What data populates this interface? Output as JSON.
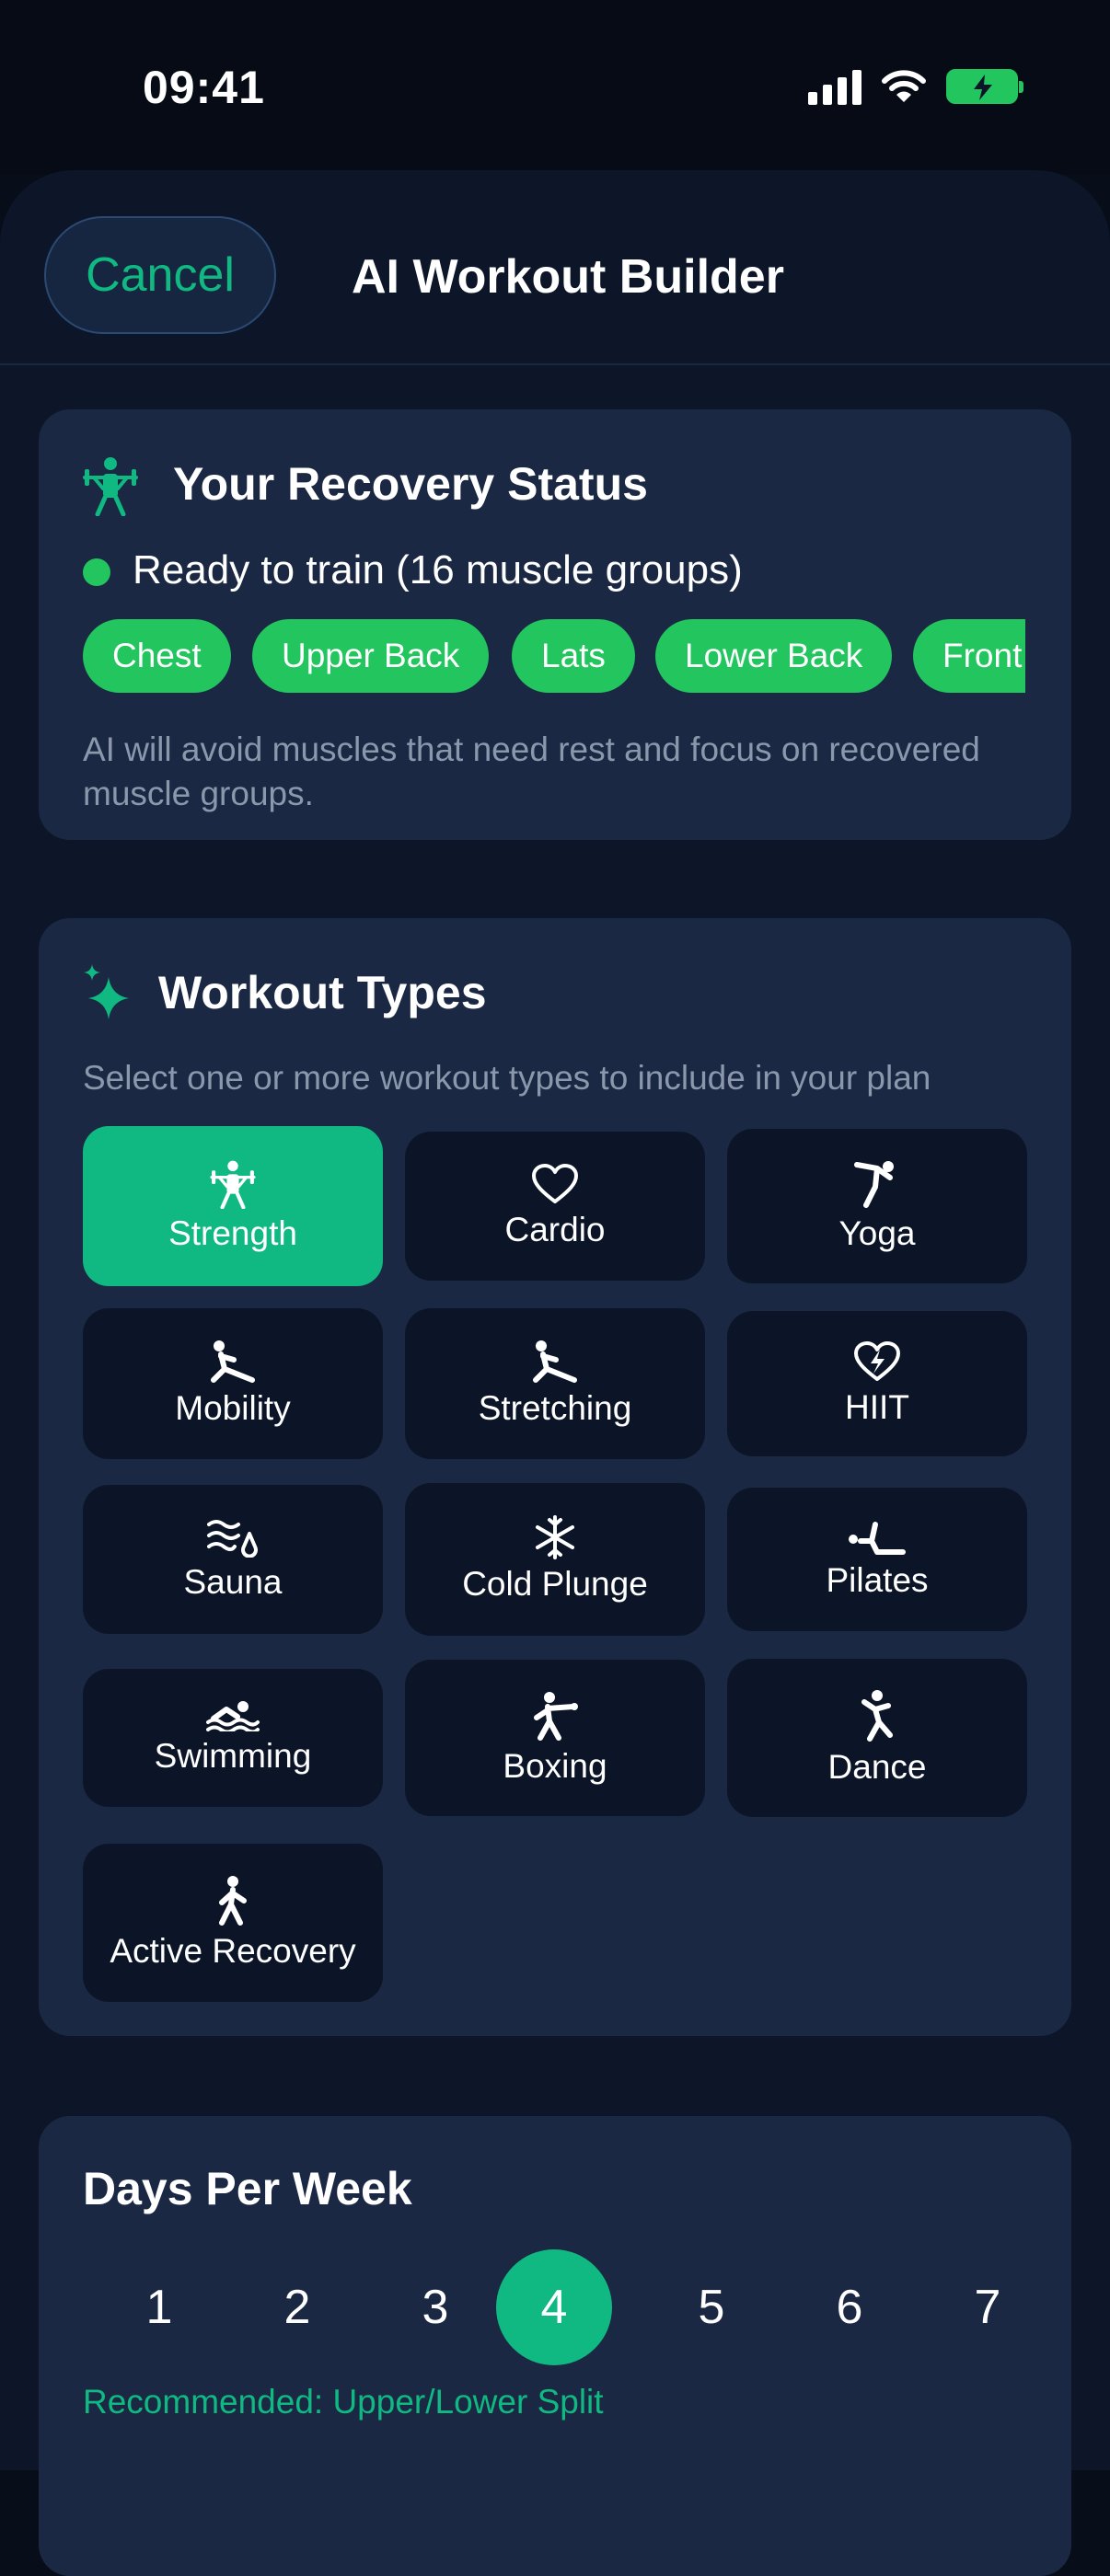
{
  "status_bar": {
    "time": "09:41"
  },
  "nav": {
    "cancel_label": "Cancel",
    "title": "AI Workout Builder"
  },
  "recovery": {
    "title": "Your Recovery Status",
    "status_text": "Ready to train (16 muscle groups)",
    "status_color": "#22c55e",
    "muscle_chips": [
      "Chest",
      "Upper Back",
      "Lats",
      "Lower Back",
      "Front"
    ],
    "note": "AI will avoid muscles that need rest and focus on recovered muscle groups."
  },
  "workout_types": {
    "title": "Workout Types",
    "subtitle": "Select one or more workout types to include in your plan",
    "items": [
      {
        "label": "Strength",
        "icon": "weightlifter-icon",
        "selected": true
      },
      {
        "label": "Cardio",
        "icon": "heart-icon",
        "selected": false
      },
      {
        "label": "Yoga",
        "icon": "yoga-pose-icon",
        "selected": false
      },
      {
        "label": "Mobility",
        "icon": "stretch-figure-icon",
        "selected": false
      },
      {
        "label": "Stretching",
        "icon": "stretch-figure-icon",
        "selected": false
      },
      {
        "label": "HIIT",
        "icon": "heart-bolt-icon",
        "selected": false
      },
      {
        "label": "Sauna",
        "icon": "heat-waves-icon",
        "selected": false
      },
      {
        "label": "Cold Plunge",
        "icon": "snowflake-icon",
        "selected": false
      },
      {
        "label": "Pilates",
        "icon": "pilates-figure-icon",
        "selected": false
      },
      {
        "label": "Swimming",
        "icon": "swimmer-icon",
        "selected": false
      },
      {
        "label": "Boxing",
        "icon": "boxer-icon",
        "selected": false
      },
      {
        "label": "Dance",
        "icon": "dancer-icon",
        "selected": false
      },
      {
        "label": "Active Recovery",
        "icon": "walking-figure-icon",
        "selected": false
      }
    ]
  },
  "days_per_week": {
    "title": "Days Per Week",
    "options": [
      "1",
      "2",
      "3",
      "4",
      "5",
      "6",
      "7"
    ],
    "selected": "4",
    "recommendation": "Recommended: Upper/Lower Split"
  },
  "colors": {
    "accent": "#10b981",
    "chip_green": "#22c55e",
    "card_bg": "#1b2844",
    "tile_bg": "#0b1527",
    "page_bg": "#070d19"
  }
}
